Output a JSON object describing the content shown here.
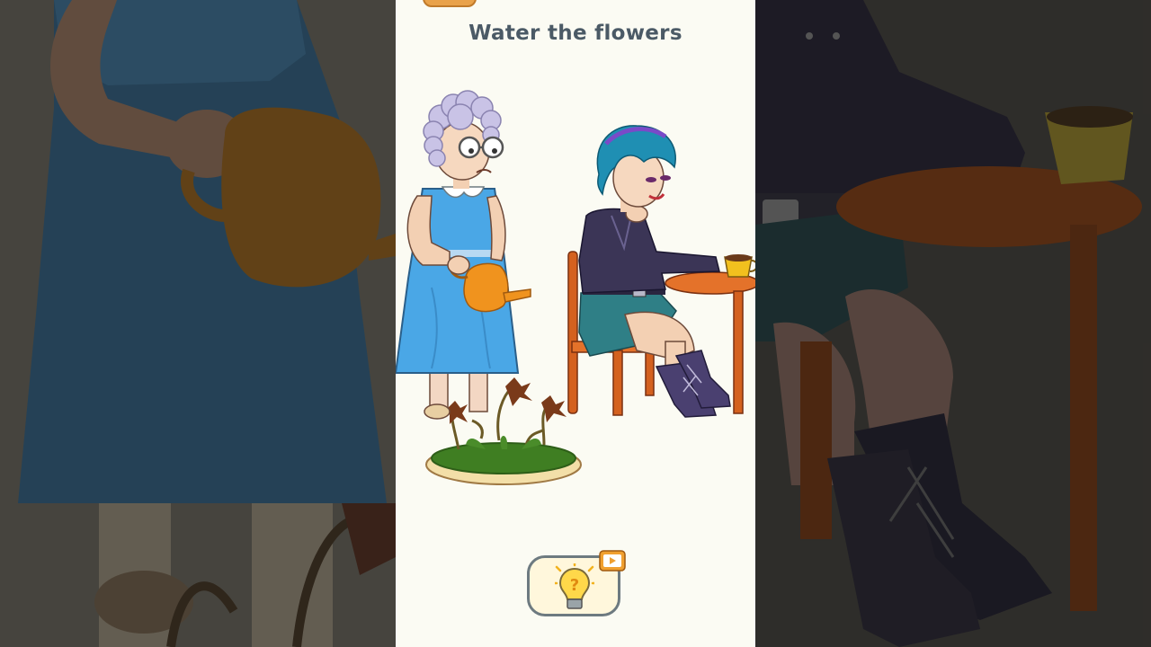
{
  "level": {
    "label": ""
  },
  "task": {
    "title": "Water the flowers"
  },
  "scene": {
    "characters": [
      "grandma-with-watering-can",
      "punk-girl-sitting"
    ],
    "objects": [
      "wilted-flowers",
      "watering-can",
      "chair",
      "table",
      "tea-cup"
    ]
  },
  "hint": {
    "icon": "lightbulb-question-icon",
    "badge_icon": "video-ad-icon"
  },
  "colors": {
    "panel_bg": "#fbfbf3",
    "title": "#4b5a66",
    "dress": "#4aa7e6",
    "jacket": "#3b3556",
    "hair_girl": "#1f8fb3",
    "hair_grandma": "#c9c3e6",
    "can": "#f0931e",
    "wood": "#d4611f",
    "grass": "#4a8c2a"
  }
}
